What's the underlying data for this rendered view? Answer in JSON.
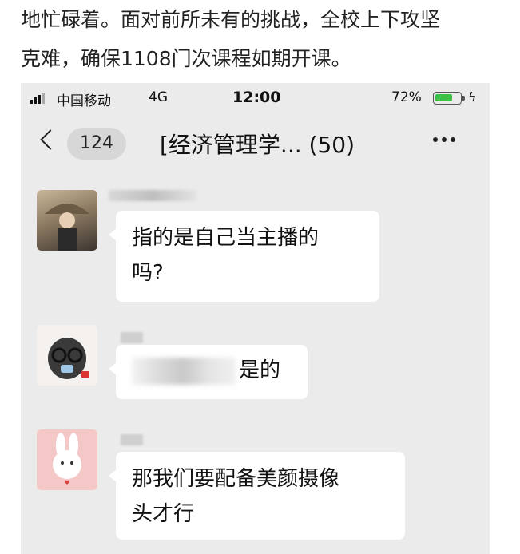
{
  "article": {
    "line1": "地忙碌着。面对前所未有的挑战，全校上下攻坚",
    "line2": "克难，确保1108门次课程如期开课。"
  },
  "status_bar": {
    "carrier": "中国移动",
    "network": "4G",
    "time": "12:00",
    "battery_percent": "72%",
    "battery_level": 0.72
  },
  "nav": {
    "unread_count": "124",
    "title": "[经济管理学... (50)"
  },
  "messages": [
    {
      "sender_name": "",
      "text": "指的是自己当主播的吗?",
      "line1": "指的是自己当主播的",
      "line2": "吗?"
    },
    {
      "sender_name": "",
      "text": "是的",
      "line1": "是的"
    },
    {
      "sender_name": "",
      "text": "那我们要配备美颜摄像头才行",
      "line1": "那我们要配备美颜摄像",
      "line2": "头才行"
    }
  ],
  "icons": {
    "back": "chevron-left-icon",
    "more": "more-dots-icon",
    "signal": "signal-icon",
    "battery": "battery-icon",
    "charging": "charging-bolt-icon"
  },
  "colors": {
    "chat_background": "#ebebeb",
    "bubble": "#ffffff",
    "battery_fill": "#3bc246"
  }
}
